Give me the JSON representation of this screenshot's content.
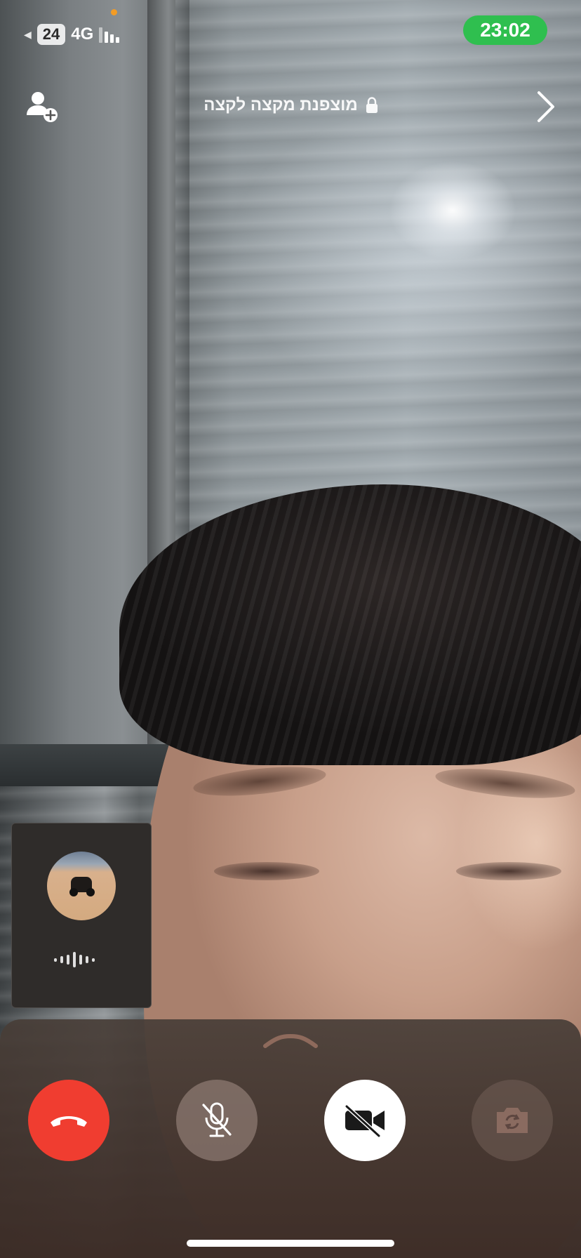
{
  "status_bar": {
    "battery": "24",
    "network": "4G",
    "time": "23:02",
    "time_pill_color": "#2fbf4f",
    "icons": [
      "back-chevron-icon",
      "signal-icon",
      "camera-in-use-dot"
    ]
  },
  "call": {
    "title": "מוצפנת מקצה לקצה",
    "icons": [
      "add-person-icon",
      "lock-icon",
      "chevron-right-icon"
    ]
  },
  "self_view": {
    "avatar": "atv-on-sand-photo",
    "indicator": "audio-wave-icon"
  },
  "controls": {
    "buttons": [
      {
        "name": "end-call",
        "icon": "phone-hangup-icon",
        "color": "#f03d30"
      },
      {
        "name": "mute",
        "icon": "mic-off-icon"
      },
      {
        "name": "video-off",
        "icon": "video-off-icon",
        "color": "#ffffff"
      },
      {
        "name": "flip-camera",
        "icon": "camera-flip-icon",
        "state": "disabled"
      }
    ],
    "handle_icon": "chevron-up-icon"
  }
}
